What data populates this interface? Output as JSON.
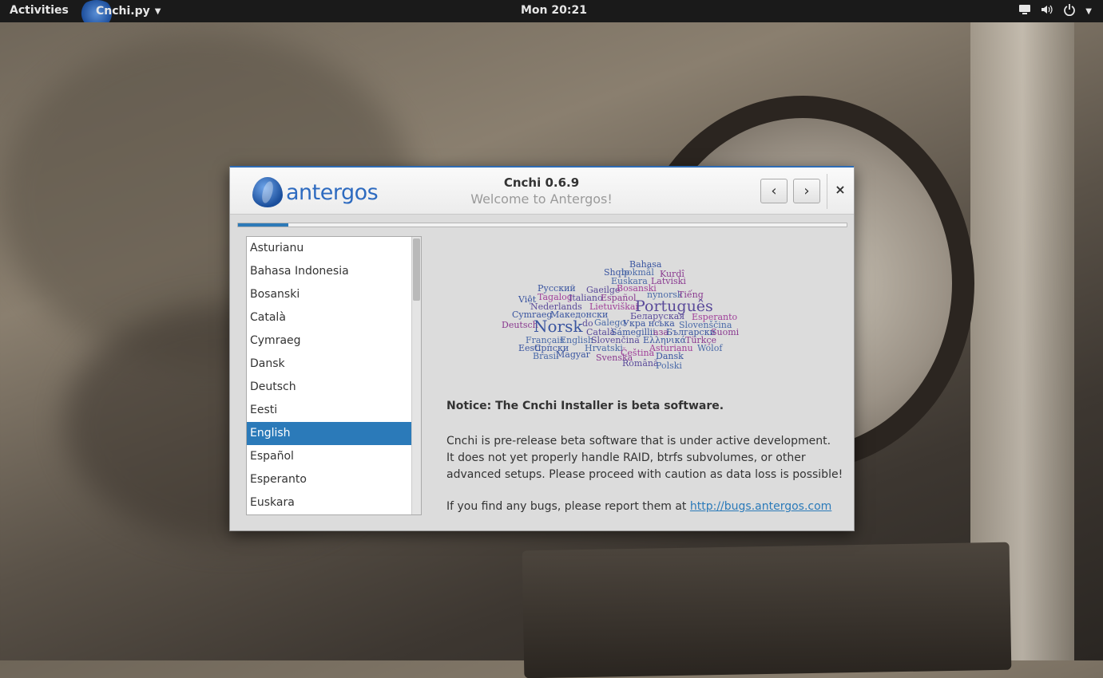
{
  "topbar": {
    "activities": "Activities",
    "app_name": "Cnchi.py",
    "clock": "Mon 20:21",
    "tray_icons": [
      "network-icon",
      "volume-icon",
      "power-icon",
      "chevron-down-icon"
    ]
  },
  "window": {
    "title": "Cnchi 0.6.9",
    "subtitle": "Welcome to Antergos!",
    "logo_text": "antergos",
    "close_glyph": "×",
    "back_glyph": "‹",
    "forward_glyph": "›",
    "progress_fraction": 0.083
  },
  "languages": {
    "items": [
      "Asturianu",
      "Bahasa Indonesia",
      "Bosanski",
      "Català",
      "Cymraeg",
      "Dansk",
      "Deutsch",
      "Eesti",
      "English",
      "Español",
      "Esperanto",
      "Euskara"
    ],
    "selected": "English"
  },
  "word_cloud": [
    {
      "text": "Bahasa",
      "color": "#3a55a0"
    },
    {
      "text": "Shqip",
      "color": "#3a55a0"
    },
    {
      "text": "bokmål",
      "color": "#4a6aa8"
    },
    {
      "text": "Kurdî",
      "color": "#8a3a90"
    },
    {
      "text": "Euskara",
      "color": "#4a6aa8"
    },
    {
      "text": "Latviski",
      "color": "#8a3a90"
    },
    {
      "text": "Русский",
      "color": "#3a55a0"
    },
    {
      "text": "Gaeilge",
      "color": "#5a4a9a"
    },
    {
      "text": "Bosanski",
      "color": "#a0409a"
    },
    {
      "text": "Việt",
      "color": "#3a55a0"
    },
    {
      "text": "Tagalog",
      "color": "#a0409a"
    },
    {
      "text": "Italiano",
      "color": "#5a4a9a"
    },
    {
      "text": "Español",
      "color": "#8a3a90"
    },
    {
      "text": "nynorsk",
      "color": "#4a6aa8"
    },
    {
      "text": "Tiếng",
      "color": "#8a3a90"
    },
    {
      "text": "Nederlands",
      "color": "#5a4a9a"
    },
    {
      "text": "Lietuviškai",
      "color": "#a0409a"
    },
    {
      "text": "Português",
      "color": "#5a4a9a"
    },
    {
      "text": "Cymraeg",
      "color": "#3a55a0"
    },
    {
      "text": "Македонски",
      "color": "#3a55a0"
    },
    {
      "text": "Беларуская",
      "color": "#5a4a9a"
    },
    {
      "text": "Esperanto",
      "color": "#a0409a"
    },
    {
      "text": "Deutsch",
      "color": "#8a3a90"
    },
    {
      "text": "Norsk",
      "color": "#3a55a0"
    },
    {
      "text": "do",
      "color": "#5a4a9a"
    },
    {
      "text": "Galego",
      "color": "#4a6aa8"
    },
    {
      "text": "Укра нська",
      "color": "#3a55a0"
    },
    {
      "text": "Slovenščina",
      "color": "#4a6aa8"
    },
    {
      "text": "Català",
      "color": "#5a4a9a"
    },
    {
      "text": "Sámegillii",
      "color": "#3a55a0"
    },
    {
      "text": "аза",
      "color": "#8a3a90"
    },
    {
      "text": "Български",
      "color": "#3a55a0"
    },
    {
      "text": "Suomi",
      "color": "#8a3a90"
    },
    {
      "text": "Français",
      "color": "#4a6aa8"
    },
    {
      "text": "English",
      "color": "#4a6aa8"
    },
    {
      "text": "Slovenčina",
      "color": "#5a4a9a"
    },
    {
      "text": "Ελληνικά",
      "color": "#3a55a0"
    },
    {
      "text": "Türkçe",
      "color": "#8a3a90"
    },
    {
      "text": "Eesti",
      "color": "#3a55a0"
    },
    {
      "text": "Српски",
      "color": "#3a55a0"
    },
    {
      "text": "Hrvatski",
      "color": "#4a6aa8"
    },
    {
      "text": "Asturianu",
      "color": "#a0409a"
    },
    {
      "text": "Wolof",
      "color": "#4a6aa8"
    },
    {
      "text": "Brasil",
      "color": "#4a6aa8"
    },
    {
      "text": "Magyar",
      "color": "#3a55a0"
    },
    {
      "text": "Čeština",
      "color": "#a0409a"
    },
    {
      "text": "Dansk",
      "color": "#3a55a0"
    },
    {
      "text": "Svenska",
      "color": "#8a3a90"
    },
    {
      "text": "Română",
      "color": "#5a4a9a"
    },
    {
      "text": "Polski",
      "color": "#4a6aa8"
    }
  ],
  "content": {
    "notice": "Notice: The Cnchi Installer is beta software.",
    "desc_line1": "Cnchi is pre-release beta software that is under active development.",
    "desc_line2": "It does not yet properly handle RAID, btrfs subvolumes, or other advanced setups. Please proceed with caution as data loss is possible!",
    "bugs_text": "If you find any bugs, please report them at",
    "bugs_link": "http://bugs.antergos.com"
  }
}
